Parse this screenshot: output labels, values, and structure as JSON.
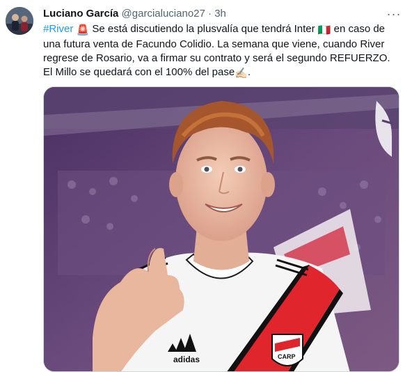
{
  "tweet": {
    "author": {
      "display_name": "Luciano García",
      "handle": "@garcialuciano27",
      "separator": "·",
      "time": "3h"
    },
    "more_icon": "more-dots-icon",
    "text": {
      "hashtag": "#River",
      "rotating_light_emoji": "🚨",
      "part1": " Se está discutiendo la plusvalía que tendrá Inter ",
      "italy_flag_emoji": "🇮🇹",
      "part2": " en caso de una futura venta de Facundo Colidio. La semana que viene, cuando River regrese de Rosario, va a firmar su contrato y será el segundo REFUERZO. El Millo se quedará con el 100% del pase",
      "writing_hand_emoji": "✍🏻",
      "part3": "."
    },
    "media": {
      "kind": "photo",
      "shirt_brand_logo_text": "adidas",
      "crest_text": "CARP"
    }
  },
  "colors": {
    "hashtag": "#1d9bf0",
    "secondary_text": "#536471",
    "media_bg": "#5a3d6b",
    "shirt_red": "#e0252d"
  }
}
